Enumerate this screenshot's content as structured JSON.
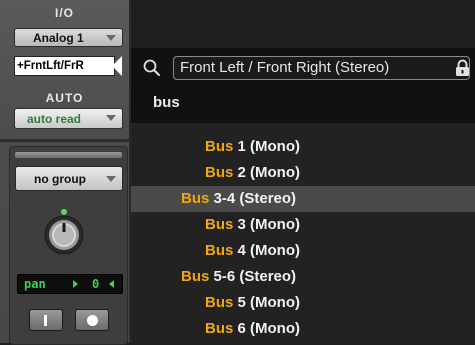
{
  "strip": {
    "io_label": "I/O",
    "input_label": "Analog 1",
    "output_label": "+FrntLft/FrR",
    "auto_label": "AUTO",
    "automation_mode": "auto read",
    "group_label": "no group",
    "pan_label": "pan",
    "pan_value": "0"
  },
  "search": {
    "path_value": "Front Left / Front Right (Stereo)",
    "query": "bus"
  },
  "list": {
    "items": [
      {
        "prefix": "Bus",
        "rest": " 1 (Mono)"
      },
      {
        "prefix": "Bus",
        "rest": " 2 (Mono)"
      },
      {
        "prefix": "Bus",
        "rest": " 3-4 (Stereo)",
        "selected": true
      },
      {
        "prefix": "Bus",
        "rest": " 3 (Mono)"
      },
      {
        "prefix": "Bus",
        "rest": " 4 (Mono)"
      },
      {
        "prefix": "Bus",
        "rest": " 5-6 (Stereo)"
      },
      {
        "prefix": "Bus",
        "rest": " 5 (Mono)"
      },
      {
        "prefix": "Bus",
        "rest": " 6 (Mono)"
      }
    ]
  },
  "colors": {
    "highlight_text": "#f0a515",
    "selected_row": "#4a4a4a",
    "pan_led": "#3cd04f",
    "automation_text": "#2e7d3e"
  },
  "icons": [
    "search-icon",
    "lock-icon",
    "pan-knob-icon",
    "record-icon",
    "input-monitor-icon"
  ]
}
